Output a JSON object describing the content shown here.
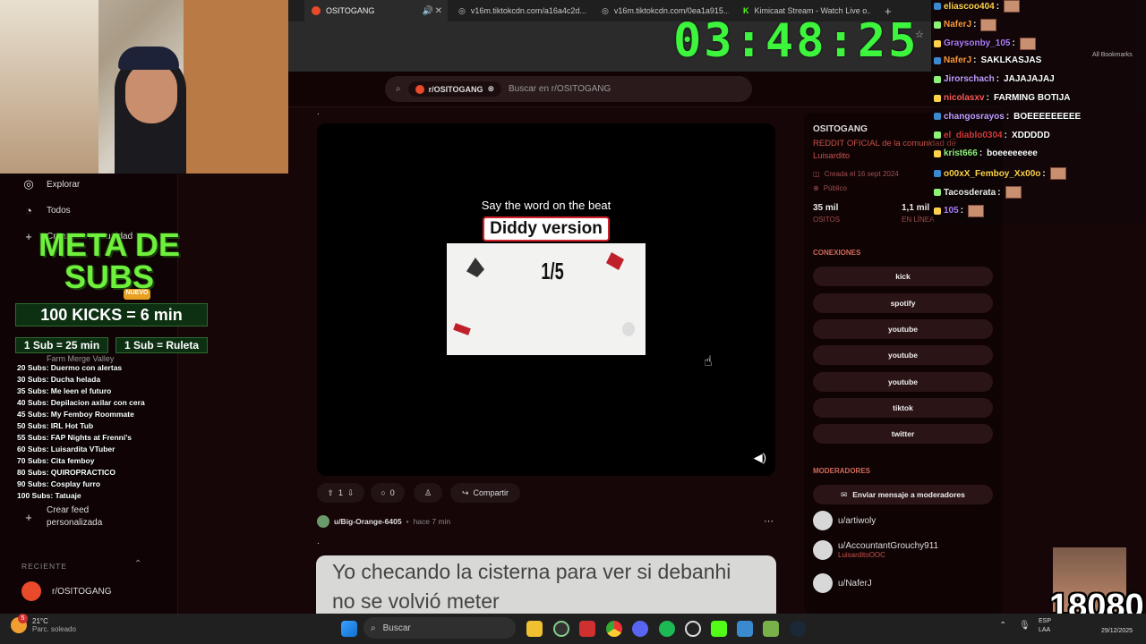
{
  "timer": "03:48:25",
  "tabs": [
    {
      "label": "OSITOGANG",
      "active": true
    },
    {
      "label": "v16m.tiktokcdn.com/a16a4c2d..."
    },
    {
      "label": "v16m.tiktokcdn.com/0ea1a915..."
    },
    {
      "label": "Kimicaat Stream - Watch Live o..."
    }
  ],
  "bookmarks": "All Bookmarks",
  "search": {
    "chip": "r/OSITOGANG",
    "placeholder": "Buscar en r/OSITOGANG"
  },
  "nav": {
    "explore": "Explorar",
    "all": "Todos",
    "create": "Crear una comunidad",
    "feed": "Crear feed personalizada",
    "recent_header": "RECIENTE",
    "recent_item": "r/OSITOGANG",
    "farm": "Farm Merge Valley"
  },
  "overlay": {
    "meta": "META DE SUBS",
    "nuevo": "NUEVO",
    "kicks": "100 KICKS = 6 min",
    "sub1": "1 Sub = 25 min",
    "sub2": "1 Sub = Ruleta",
    "goals": [
      "20 Subs: Duermo con alertas",
      "30 Subs: Ducha helada",
      "35 Subs: Me leen el futuro",
      "40 Subs: Depilacion axilar con cera",
      "45 Subs: My Femboy Roommate",
      "50 Subs: IRL Hot Tub",
      "55 Subs: FAP Nights at Frenni's",
      "60 Subs: Luisardita VTuber",
      "70 Subs: Cita femboy",
      "80 Subs: QUIROPRACTICO",
      "90 Subs: Cosplay furro",
      "100 Subs: Tatuaje"
    ]
  },
  "post": {
    "line1": "Say the word on the beat",
    "line2": "Diddy version",
    "counter": "1/5",
    "votes": "1",
    "comments": "0",
    "share": "Compartir",
    "next_author": "u/Big-Orange-6405",
    "next_time": "hace 7 min",
    "next_text": "Yo checando la cisterna para ver si debanhi no se volvió meter"
  },
  "community": {
    "name": "OSITOGANG",
    "desc": "REDDIT OFICIAL de la comunidad de Luisardito",
    "created": "Creada el 16 sept 2024",
    "visibility": "Público",
    "members": "35 mil",
    "members_label": "OSITOS",
    "online": "1,1 mil",
    "online_label": "EN LÍNEA",
    "connections_header": "CONEXIONES",
    "links": [
      "kick",
      "spotify",
      "youtube",
      "youtube",
      "youtube",
      "tiktok",
      "twitter"
    ],
    "mods_header": "MODERADORES",
    "message_mods": "Enviar mensaje a moderadores",
    "mods": [
      {
        "name": "u/artiwoly",
        "sub": ""
      },
      {
        "name": "u/AccountantGrouchy911",
        "sub": "LuisarditoOOC"
      },
      {
        "name": "u/NaferJ",
        "sub": ""
      }
    ]
  },
  "chat": [
    {
      "user": "eliascoo404",
      "msg": "",
      "color": "#ffd24a"
    },
    {
      "user": "NaferJ",
      "msg": "",
      "color": "#ff9a3c"
    },
    {
      "user": "Graysonby_105",
      "msg": "",
      "color": "#b07cff"
    },
    {
      "user": "NaferJ",
      "msg": "SAKLKASJAS",
      "color": "#ff9a3c"
    },
    {
      "user": "Jirorschach",
      "msg": "JAJAJAJAJ",
      "color": "#c49cff"
    },
    {
      "user": "nicolasxv",
      "msg": "FARMING BOTIJA",
      "color": "#ff5a5a"
    },
    {
      "user": "changosrayos",
      "msg": "BOEEEEEEEEE",
      "color": "#c49cff"
    },
    {
      "user": "el_diablo0304",
      "msg": "XDDDDD",
      "color": "#d83a3a"
    },
    {
      "user": "krist666",
      "msg": "boeeeeeeee",
      "color": "#8ff07a"
    },
    {
      "user": "o00xX_Femboy_Xx00o",
      "msg": "",
      "color": "#ffd24a"
    },
    {
      "user": "Tacosderata",
      "msg": "",
      "color": "#e8e8e8"
    },
    {
      "user": "105",
      "msg": "",
      "color": "#b07cff"
    }
  ],
  "sub_counter": "18080",
  "taskbar": {
    "weather_temp": "21°C",
    "weather_desc": "Parc. soleado",
    "search": "Buscar",
    "lang1": "ESP",
    "lang2": "LAA",
    "date": "29/12/2025",
    "badge": "5"
  }
}
